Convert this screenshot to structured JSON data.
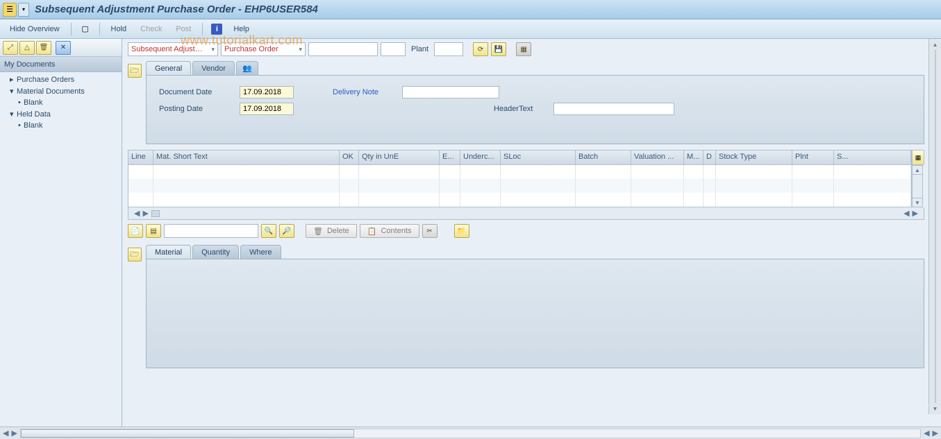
{
  "title": "Subsequent Adjustment Purchase Order - EHP6USER584",
  "watermark": "www.tutorialkart.com",
  "menu": {
    "hide_overview": "Hide Overview",
    "hold": "Hold",
    "check": "Check",
    "post": "Post",
    "help": "Help"
  },
  "sidebar": {
    "header": "My Documents",
    "items": [
      {
        "label": "Purchase Orders",
        "expanded": false
      },
      {
        "label": "Material Documents",
        "expanded": true,
        "children": [
          {
            "label": "Blank"
          }
        ]
      },
      {
        "label": "Held Data",
        "expanded": true,
        "children": [
          {
            "label": "Blank"
          }
        ]
      }
    ]
  },
  "top": {
    "action_dd": "Subsequent Adjust…",
    "ref_dd": "Purchase Order",
    "field1": "",
    "field2": "",
    "plant_label": "Plant",
    "plant_value": ""
  },
  "header_tabs": {
    "general": "General",
    "vendor": "Vendor",
    "form": {
      "doc_date_label": "Document Date",
      "doc_date": "17.09.2018",
      "posting_date_label": "Posting Date",
      "posting_date": "17.09.2018",
      "delivery_note_label": "Delivery Note",
      "delivery_note": "",
      "header_text_label": "HeaderText",
      "header_text": ""
    }
  },
  "grid": {
    "columns": [
      "Line",
      "Mat. Short Text",
      "OK",
      "Qty in UnE",
      "E...",
      "Underc...",
      "SLoc",
      "Batch",
      "Valuation ...",
      "M...",
      "D",
      "Stock Type",
      "Plnt",
      "S..."
    ]
  },
  "item_toolbar": {
    "delete": "Delete",
    "contents": "Contents"
  },
  "detail_tabs": {
    "material": "Material",
    "quantity": "Quantity",
    "where": "Where"
  }
}
